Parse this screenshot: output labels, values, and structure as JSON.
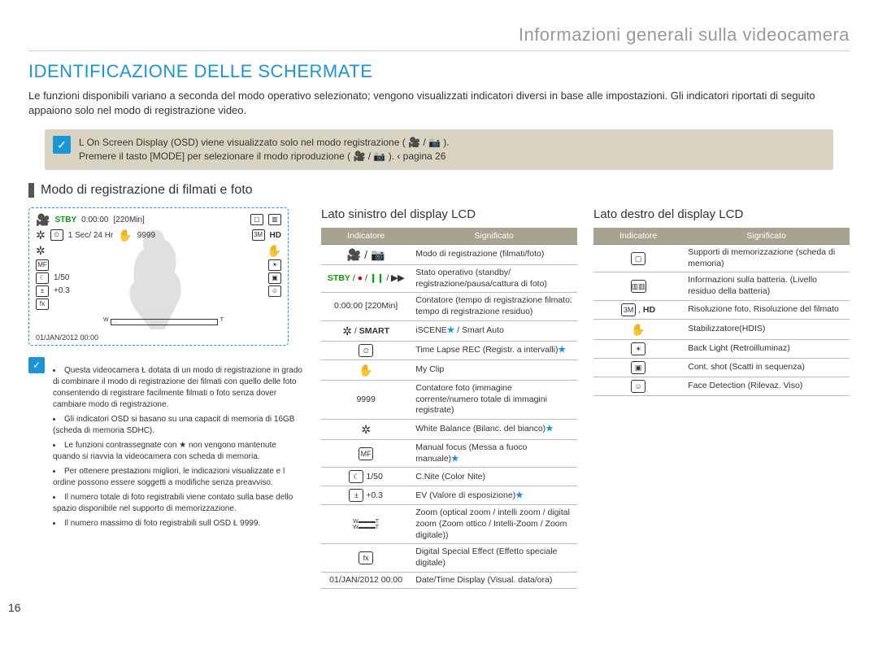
{
  "header": {
    "chapter_title": "Informazioni generali sulla videocamera",
    "section_title": "IDENTIFICAZIONE DELLE SCHERMATE",
    "lead_text": "Le funzioni disponibili variano a seconda del modo operativo selezionato; vengono visualizzati indicatori diversi in base alle impostazioni. Gli indicatori riportati di seguito appaiono solo nel modo di registrazione video.",
    "page_number": "16"
  },
  "note_box": {
    "line1": "L On Screen Display (OSD) viene visualizzato solo nel modo registrazione ( 🎥 / 📷 ).",
    "line2": "Premere il tasto [MODE] per selezionare il modo riproduzione ( 🎥 / 📷 ).  ‹ pagina 26"
  },
  "subsection_title": "Modo di registrazione di filmati e foto",
  "screen": {
    "stby": "STBY",
    "timer": "0:00:00",
    "remaining": "[220Min]",
    "timelapse": "1 Sec/ 24 Hr",
    "counter": "9999",
    "cnite": "1/50",
    "ev": "+0.3",
    "datetime": "01/JAN/2012 00:00"
  },
  "notes": {
    "items": [
      "Questa videocamera Ł dotata di un modo di registrazione in grado di combinare il modo di registrazione dei filmati con quello delle foto consentendo di registrare facilmente filmati o foto senza dover cambiare modo di registrazione.",
      "Gli indicatori OSD si basano su una capacit di memoria di 16GB (scheda di memoria SDHC).",
      "Le funzioni contrassegnate con ★ non vengono mantenute quando si riavvia la videocamera con scheda di memoria.",
      "Per ottenere prestazioni migliori, le indicazioni visualizzate e l ordine possono essere soggetti a modifiche senza preavviso.",
      "Il numero totale di foto registrabili viene contato sulla base dello spazio disponibile nel supporto di memorizzazione.",
      "Il numero massimo di foto registrabili sull OSD Ł 9999."
    ]
  },
  "left_table": {
    "title": "Lato sinistro del display LCD",
    "header_indicator": "Indicatore",
    "header_meaning": "Significato",
    "rows": [
      {
        "ind": "🎥 / 📷",
        "ind_class": "glyph-plain",
        "txt": "Modo di registrazione (filmati/foto)"
      },
      {
        "ind_html": "<span class='status-green'>STBY</span> / <span class='status-red'>●</span> / <span class='status-green'>❙❙</span> / <b>▶▶</b>",
        "txt": "Stato operativo (standby/ registrazione/pausa/cattura di foto)"
      },
      {
        "ind": "0:00:00 [220Min]",
        "txt": "Contatore (tempo di registrazione filmato: tempo di registrazione residuo)"
      },
      {
        "ind_html": "<span class='glyph-plain'>✲</span> / <b>SMART</b>",
        "txt_html": "iSCENE<span class='star'>★</span> / Smart Auto"
      },
      {
        "ind_html": "<span class='glyph'>⏲</span>",
        "txt_html": "Time Lapse REC (Registr. a intervalli)<span class='star'>★</span>"
      },
      {
        "ind_html": "<span class='glyph-plain'>✋</span>",
        "txt": "My Clip"
      },
      {
        "ind": "9999",
        "txt": "Contatore foto (immagine corrente/numero totale di immagini registrate)"
      },
      {
        "ind_html": "<span class='glyph-plain'>✲</span>",
        "txt_html": "White Balance (Bilanc. del bianco)<span class='star'>★</span>"
      },
      {
        "ind_html": "<span class='glyph'>MF</span>",
        "txt_html": "Manual focus (Messa a fuoco manuale)<span class='star'>★</span>"
      },
      {
        "ind_html": "<span class='glyph'>☾</span> 1/50",
        "txt": "C.Nite (Color Nite)"
      },
      {
        "ind_html": "<span class='glyph'>±</span> +0.3",
        "txt_html": "EV (Valore di esposizione)<span class='star'>★</span>"
      },
      {
        "ind_html": "<div style='font-size:7px;line-height:1'>W▬▬▬T<br>W▬▬▬T</div>",
        "txt": "Zoom (optical zoom / intelli zoom / digital zoom (Zoom ottico / Intelli-Zoom / Zoom digitale))"
      },
      {
        "ind_html": "<span class='glyph'>fx</span>",
        "txt": "Digital Special Effect (Effetto speciale digitale)"
      },
      {
        "ind": "01/JAN/2012 00:00",
        "txt": "Date/Time Display (Visual. data/ora)"
      }
    ]
  },
  "right_table": {
    "title": "Lato destro del display LCD",
    "header_indicator": "Indicatore",
    "header_meaning": "Significato",
    "rows": [
      {
        "ind_html": "<span class='glyph'>▢</span>",
        "txt": "Supporti di memorizzazione (scheda di memoria)"
      },
      {
        "ind_html": "<span class='glyph'>▥▥</span>",
        "txt": "Informazioni sulla batteria. (Livello residuo della batteria)"
      },
      {
        "ind_html": "<span class='glyph'>3M</span> , <b>HD</b>",
        "txt": "Risoluzione foto, Risoluzione del filmato"
      },
      {
        "ind_html": "<span class='glyph-plain'>✋</span>",
        "txt": "Stabilizzatore(HDIS)"
      },
      {
        "ind_html": "<span class='glyph'>☀</span>",
        "txt": "Back Light (Retroilluminaz)"
      },
      {
        "ind_html": "<span class='glyph'>▣</span>",
        "txt": "Cont. shot (Scatti in sequenza)"
      },
      {
        "ind_html": "<span class='glyph'>☺</span>",
        "txt": "Face Detection (Rilevaz. Viso)"
      }
    ]
  }
}
